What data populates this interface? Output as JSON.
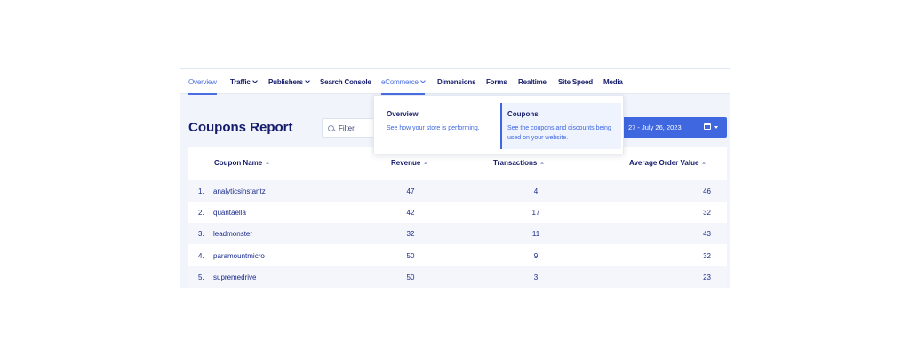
{
  "nav": {
    "items": [
      {
        "label": "Overview",
        "dropdown": false
      },
      {
        "label": "Traffic",
        "dropdown": true
      },
      {
        "label": "Publishers",
        "dropdown": true
      },
      {
        "label": "Search Console",
        "dropdown": false
      },
      {
        "label": "eCommerce",
        "dropdown": true
      },
      {
        "label": "Dimensions",
        "dropdown": false
      },
      {
        "label": "Forms",
        "dropdown": false
      },
      {
        "label": "Realtime",
        "dropdown": false
      },
      {
        "label": "Site Speed",
        "dropdown": false
      },
      {
        "label": "Media",
        "dropdown": false
      }
    ],
    "active": "Overview",
    "open_menu": "eCommerce"
  },
  "dropdown": {
    "items": [
      {
        "title": "Overview",
        "description": "See how your store is performing."
      },
      {
        "title": "Coupons",
        "description": "See the coupons and discounts being used on your website."
      }
    ]
  },
  "report": {
    "title": "Coupons Report",
    "filter_placeholder": "Filter",
    "date_range": "27 - July 26, 2023",
    "icons": {
      "filter": "search-icon",
      "date": "calendar-icon",
      "date_menu": "caret-down-icon",
      "sort": "sort-up-icon"
    },
    "columns": [
      "Coupon Name",
      "Revenue",
      "Transactions",
      "Average Order Value"
    ],
    "rows": [
      {
        "index": "1.",
        "name": "analyticsinstantz",
        "revenue": "47",
        "transactions": "4",
        "aov": "46"
      },
      {
        "index": "2.",
        "name": "quantaella",
        "revenue": "42",
        "transactions": "17",
        "aov": "32"
      },
      {
        "index": "3.",
        "name": "leadmonster",
        "revenue": "32",
        "transactions": "11",
        "aov": "43"
      },
      {
        "index": "4.",
        "name": "paramountmicro",
        "revenue": "50",
        "transactions": "9",
        "aov": "32"
      },
      {
        "index": "5.",
        "name": "supremedrive",
        "revenue": "50",
        "transactions": "3",
        "aov": "23"
      }
    ]
  },
  "colors": {
    "accent": "#3e67e0",
    "text": "#141c6b",
    "panel": "#f1f4fb"
  }
}
